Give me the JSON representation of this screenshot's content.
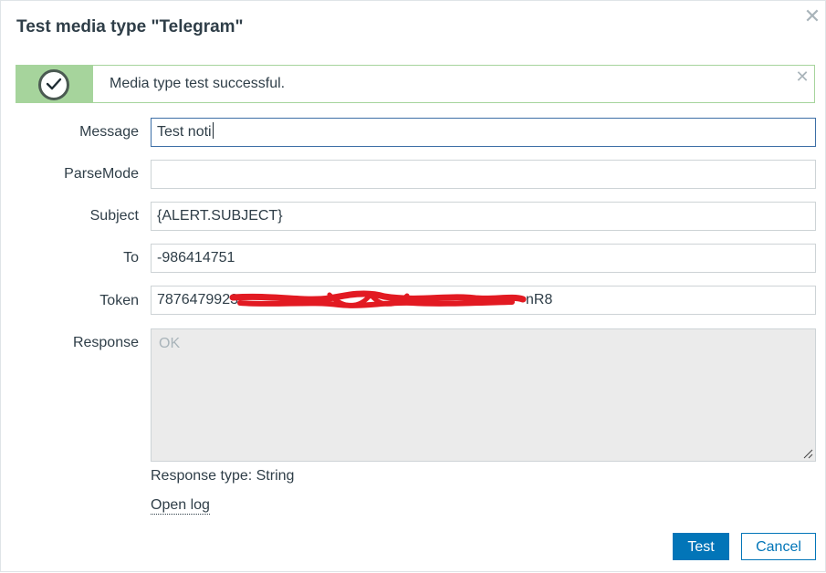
{
  "dialog": {
    "title": "Test media type \"Telegram\"",
    "close_icon": "close-icon"
  },
  "message_box": {
    "text": "Media type test successful.",
    "icon": "check-circle-icon",
    "close_icon": "close-icon",
    "color": "#a6d49c"
  },
  "fields": {
    "message": {
      "label": "Message",
      "value": "Test noti"
    },
    "parse_mode": {
      "label": "ParseMode",
      "value": ""
    },
    "subject": {
      "label": "Subject",
      "value": "{ALERT.SUBJECT}"
    },
    "to": {
      "label": "To",
      "value": "-986414751"
    },
    "token": {
      "label": "Token",
      "value_start": "7876479923",
      "value_end": "nR8",
      "redacted": true
    }
  },
  "response": {
    "label": "Response",
    "value": "OK",
    "type_text": "Response type: String",
    "open_log": "Open log"
  },
  "buttons": {
    "test": "Test",
    "cancel": "Cancel",
    "accent": "#0275b8"
  }
}
